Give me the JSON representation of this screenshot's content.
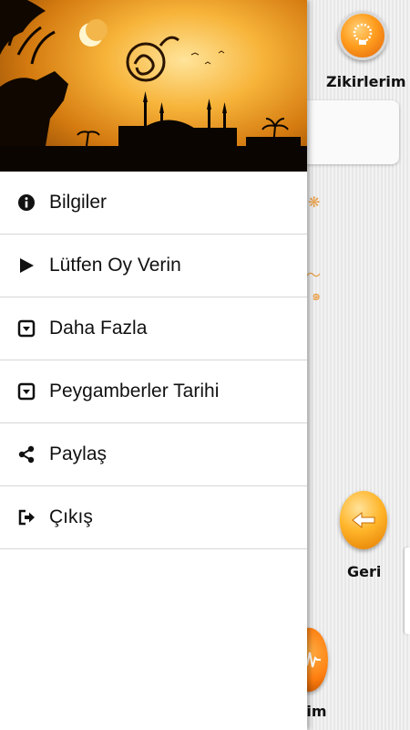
{
  "background_app": {
    "zikirlerim_label": "Zikirlerim",
    "geri_label": "Geri",
    "bottom_label": "eşim"
  },
  "drawer": {
    "items": [
      {
        "label": "Bilgiler",
        "icon": "info-circle-icon"
      },
      {
        "label": "Lütfen Oy Verin",
        "icon": "play-icon"
      },
      {
        "label": "Daha Fazla",
        "icon": "caret-square-down-icon"
      },
      {
        "label": "Peygamberler Tarihi",
        "icon": "caret-square-down-icon"
      },
      {
        "label": "Paylaş",
        "icon": "share-icon"
      },
      {
        "label": "Çıkış",
        "icon": "sign-out-icon"
      }
    ]
  },
  "colors": {
    "accent_orange": "#ff9d1e",
    "text": "#111111",
    "divider": "#d6d6d6"
  }
}
